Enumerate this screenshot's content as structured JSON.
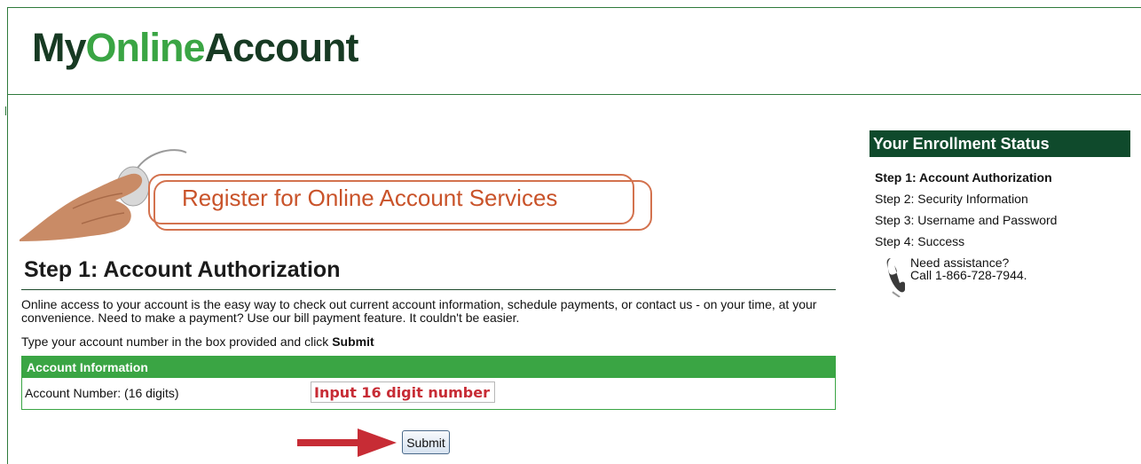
{
  "header": {
    "logo_part1": "My",
    "logo_part2": "Online",
    "logo_part3": "Account"
  },
  "banner": {
    "title": "Register for Online Account Services"
  },
  "main": {
    "step_title": "Step 1: Account Authorization",
    "intro_text": "Online access to your account is the easy way to check out current account information, schedule payments, or contact us - on your time, at your convenience.  Need to make a payment?  Use our bill payment feature.  It couldn't be easier.",
    "instruction_text": "Type your account number in the box provided and click ",
    "instruction_bold": "Submit",
    "account_box": {
      "header": "Account Information",
      "field_label": "Account Number: (16 digits)",
      "field_placeholder": "Input 16 digit number",
      "field_value": ""
    },
    "submit_label": "Submit"
  },
  "sidebar": {
    "title": "Your Enrollment Status",
    "steps": [
      {
        "label": "Step 1: Account Authorization",
        "current": true
      },
      {
        "label": "Step 2: Security Information",
        "current": false
      },
      {
        "label": "Step 3: Username and Password",
        "current": false
      },
      {
        "label": "Step 4: Success",
        "current": false
      }
    ],
    "assist_line1": "Need assistance?",
    "assist_line2": "Call 1-866-728-7944."
  },
  "colors": {
    "brand_dark": "#173a23",
    "brand_green": "#3aa544",
    "sidebar_header": "#0f4a2c",
    "banner_text": "#c9532a",
    "annotation_red": "#c72c35"
  },
  "icons": {
    "mouse_hand": "hand-on-mouse-icon",
    "phone": "phone-icon",
    "arrow": "arrow-right-icon"
  }
}
